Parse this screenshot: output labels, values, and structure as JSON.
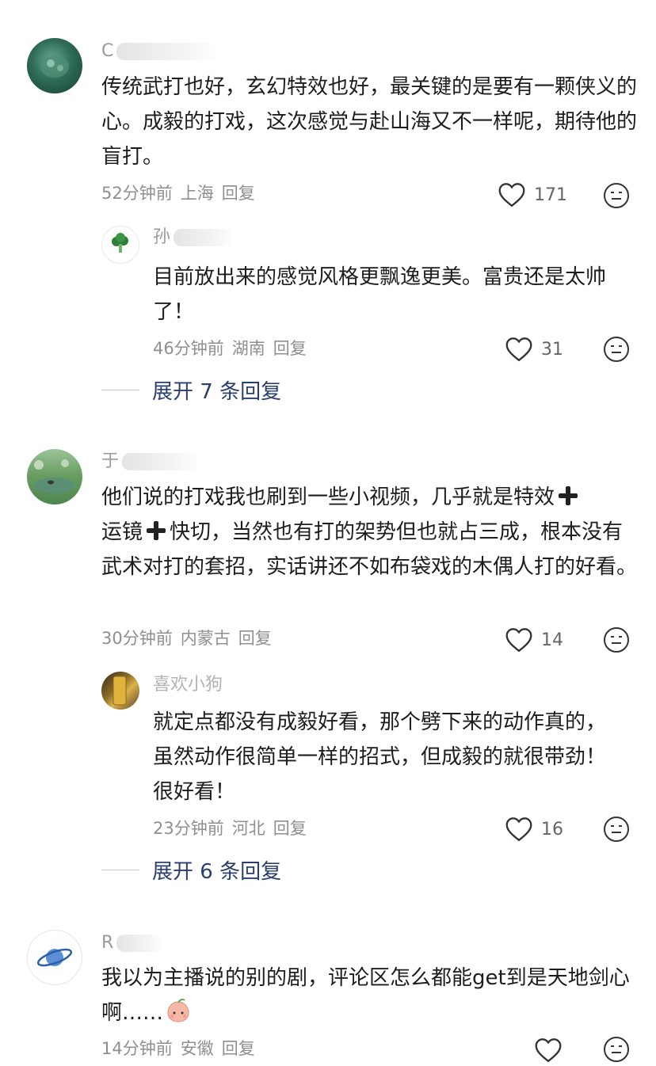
{
  "comments": [
    {
      "name_visible": "C",
      "text": "传统武打也好，玄幻特效也好，最关键的是要有一颗侠义的心。成毅的打戏，这次感觉与赴山海又不一样呢，期待他的盲打。",
      "time": "52分钟前",
      "location": "上海",
      "reply_label": "回复",
      "likes": "171",
      "reply": {
        "name_visible": "孙",
        "text": "目前放出来的感觉风格更飘逸更美。富贵还是太帅了！",
        "time": "46分钟前",
        "location": "湖南",
        "reply_label": "回复",
        "likes": "31"
      },
      "expand_label": "展开 7 条回复"
    },
    {
      "name_visible": "于",
      "text_parts": [
        "他们说的打戏我也刷到一些小视频，几乎就是特效",
        "运镜",
        "快切，当然也有打的架势但也就占三成，根本没有武术对打的套招，实话讲还不如布袋戏的木偶人打的好看。"
      ],
      "time": "30分钟前",
      "location": "内蒙古",
      "reply_label": "回复",
      "likes": "14",
      "reply": {
        "name_visible": "喜欢小狗",
        "text": "就定点都没有成毅好看，那个劈下来的动作真的，虽然动作很简单一样的招式，但成毅的就很带劲！很好看！",
        "time": "23分钟前",
        "location": "河北",
        "reply_label": "回复",
        "likes": "16"
      },
      "expand_label": "展开 6 条回复"
    },
    {
      "name_visible": "R",
      "text": "我以为主播说的别的剧，评论区怎么都能get到是天地剑心啊……",
      "time": "14分钟前",
      "location": "安徽",
      "reply_label": "回复"
    }
  ],
  "icons": {
    "like": "heart-outline-icon",
    "react": "smile-face-icon",
    "emoji": "peach-emoji-icon"
  },
  "colors": {
    "text": "#1d1d1d",
    "meta": "#8f8f8f",
    "expand": "#2b3f6e"
  }
}
